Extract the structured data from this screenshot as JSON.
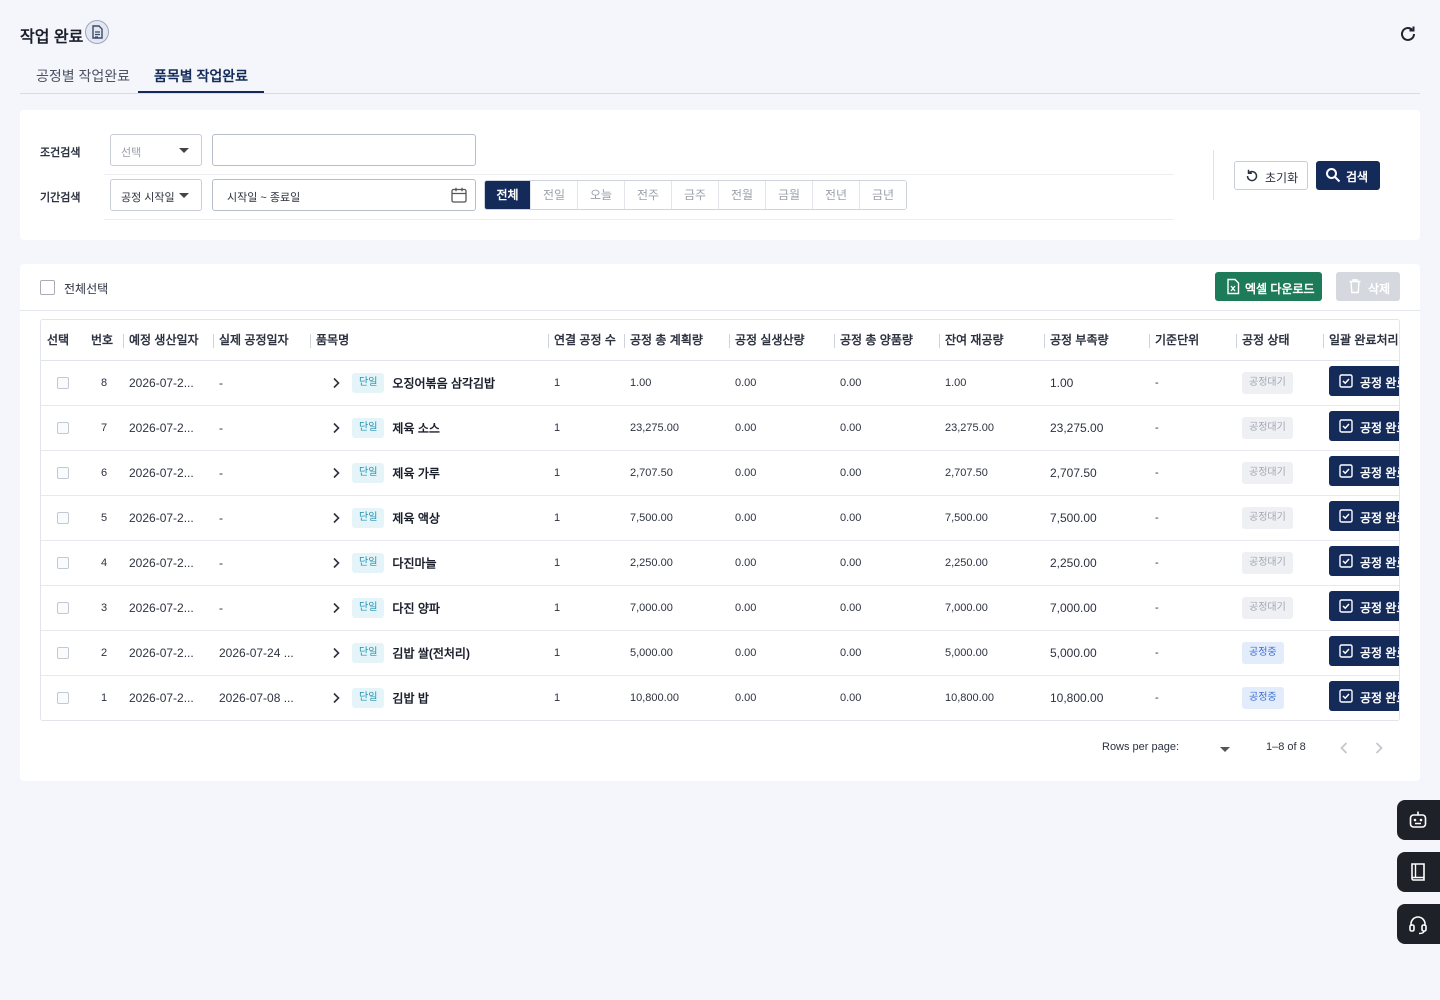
{
  "header": {
    "title": "작업 완료"
  },
  "tabs": [
    {
      "label": "공정별 작업완료"
    },
    {
      "label": "품목별 작업완료"
    }
  ],
  "search": {
    "condition_label": "조건검색",
    "condition_select_placeholder": "선택",
    "condition_input_value": "",
    "period_label": "기간검색",
    "period_select_value": "공정 시작일",
    "date_range_placeholder": "시작일 ~ 종료일",
    "period_buttons": [
      "전체",
      "전일",
      "오늘",
      "전주",
      "금주",
      "전월",
      "금월",
      "전년",
      "금년"
    ],
    "reset_label": "초기화",
    "search_label": "검색"
  },
  "list": {
    "select_all_label": "전체선택",
    "excel_label": "엑셀 다운로드",
    "delete_label": "삭제",
    "columns": [
      "선택",
      "번호",
      "예정 생산일자",
      "실제 공정일자",
      "품목명",
      "연결 공정 수",
      "공정 총 계획량",
      "공정 실생산량",
      "공정 총 양품량",
      "잔여 재공량",
      "공정 부족량",
      "기준단위",
      "공정 상태",
      "일괄 완료처리"
    ],
    "rows": [
      {
        "no": "8",
        "planned": "2026-07-2...",
        "actual": "-",
        "type": "단일",
        "item": "오징어볶음 삼각김밥",
        "links": "1",
        "plan_qty": "1.00",
        "real_qty": "0.00",
        "good_qty": "0.00",
        "wip": "1.00",
        "short": "1.00",
        "unit": "-",
        "status": "공정대기",
        "action": "공정 완료"
      },
      {
        "no": "7",
        "planned": "2026-07-2...",
        "actual": "-",
        "type": "단일",
        "item": "제육 소스",
        "links": "1",
        "plan_qty": "23,275.00",
        "real_qty": "0.00",
        "good_qty": "0.00",
        "wip": "23,275.00",
        "short": "23,275.00",
        "unit": "-",
        "status": "공정대기",
        "action": "공정 완료"
      },
      {
        "no": "6",
        "planned": "2026-07-2...",
        "actual": "-",
        "type": "단일",
        "item": "제육 가루",
        "links": "1",
        "plan_qty": "2,707.50",
        "real_qty": "0.00",
        "good_qty": "0.00",
        "wip": "2,707.50",
        "short": "2,707.50",
        "unit": "-",
        "status": "공정대기",
        "action": "공정 완료"
      },
      {
        "no": "5",
        "planned": "2026-07-2...",
        "actual": "-",
        "type": "단일",
        "item": "제육 액상",
        "links": "1",
        "plan_qty": "7,500.00",
        "real_qty": "0.00",
        "good_qty": "0.00",
        "wip": "7,500.00",
        "short": "7,500.00",
        "unit": "-",
        "status": "공정대기",
        "action": "공정 완료"
      },
      {
        "no": "4",
        "planned": "2026-07-2...",
        "actual": "-",
        "type": "단일",
        "item": "다진마늘",
        "links": "1",
        "plan_qty": "2,250.00",
        "real_qty": "0.00",
        "good_qty": "0.00",
        "wip": "2,250.00",
        "short": "2,250.00",
        "unit": "-",
        "status": "공정대기",
        "action": "공정 완료"
      },
      {
        "no": "3",
        "planned": "2026-07-2...",
        "actual": "-",
        "type": "단일",
        "item": "다진 양파",
        "links": "1",
        "plan_qty": "7,000.00",
        "real_qty": "0.00",
        "good_qty": "0.00",
        "wip": "7,000.00",
        "short": "7,000.00",
        "unit": "-",
        "status": "공정대기",
        "action": "공정 완료"
      },
      {
        "no": "2",
        "planned": "2026-07-2...",
        "actual": "2026-07-24 ...",
        "type": "단일",
        "item": "김밥 쌀(전처리)",
        "links": "1",
        "plan_qty": "5,000.00",
        "real_qty": "0.00",
        "good_qty": "0.00",
        "wip": "5,000.00",
        "short": "5,000.00",
        "unit": "-",
        "status": "공정중",
        "action": "공정 완료"
      },
      {
        "no": "1",
        "planned": "2026-07-2...",
        "actual": "2026-07-08 ...",
        "type": "단일",
        "item": "김밥 밥",
        "links": "1",
        "plan_qty": "10,800.00",
        "real_qty": "0.00",
        "good_qty": "0.00",
        "wip": "10,800.00",
        "short": "10,800.00",
        "unit": "-",
        "status": "공정중",
        "action": "공정 완료"
      }
    ]
  },
  "pagination": {
    "rows_per_page_label": "Rows per page:",
    "rows_per_page_value": "",
    "range_text": "1–8 of 8"
  },
  "colors": {
    "primary": "#142a59",
    "excel": "#1e7b5a",
    "badge_type": "#1f93b1",
    "status_running": "#3b6fd4"
  },
  "icons": [
    "document-icon",
    "refresh-icon",
    "calendar-icon",
    "reset-icon",
    "search-icon",
    "excel-icon",
    "trash-icon",
    "chevron-right-icon",
    "check-square-icon",
    "chevron-left-icon",
    "chatbot-icon",
    "book-icon",
    "headset-icon"
  ]
}
